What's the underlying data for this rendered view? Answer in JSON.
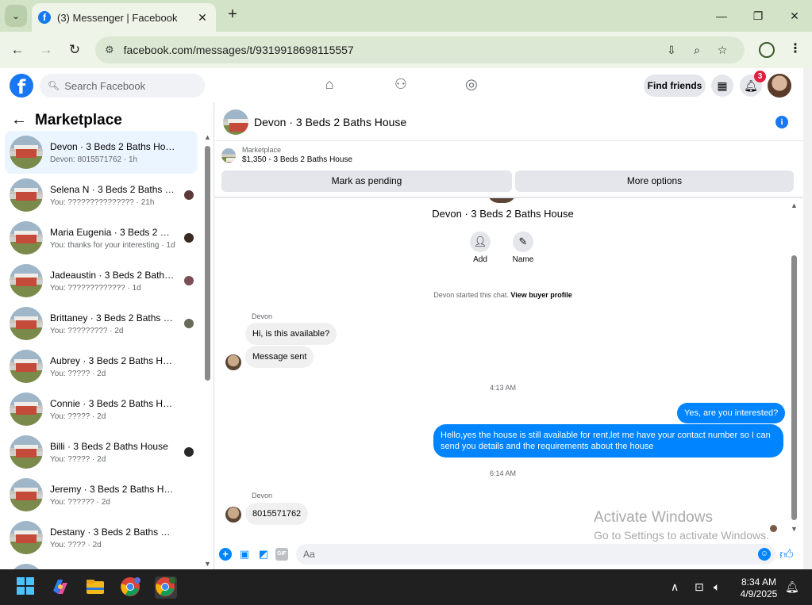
{
  "browser": {
    "tab_title": "(3) Messenger | Facebook",
    "url": "facebook.com/messages/t/9319918698115557"
  },
  "fb_header": {
    "search_placeholder": "Search Facebook",
    "find_friends": "Find friends",
    "notification_count": "3"
  },
  "sidebar": {
    "title": "Marketplace",
    "conversations": [
      {
        "name": "Devon · 3 Beds 2 Baths House",
        "preview": "Devon: 8015571762 · 1h",
        "active": true
      },
      {
        "name": "Selena N · 3 Beds 2 Baths Ho...",
        "preview": "You: ??????????????? · 21h"
      },
      {
        "name": "Maria Eugenia · 3 Beds 2 Bat...",
        "preview": "You: thanks for your interesting · 1d"
      },
      {
        "name": "Jadeaustin · 3 Beds 2 Baths H...",
        "preview": "You: ????????????? · 1d"
      },
      {
        "name": "Brittaney · 3 Beds 2 Baths Ho...",
        "preview": "You: ????????? · 2d"
      },
      {
        "name": "Aubrey · 3 Beds 2 Baths House",
        "preview": "You: ????? · 2d"
      },
      {
        "name": "Connie · 3 Beds 2 Baths House",
        "preview": "You: ????? · 2d"
      },
      {
        "name": "Billi · 3 Beds 2 Baths House",
        "preview": "You: ????? · 2d"
      },
      {
        "name": "Jeremy · 3 Beds 2 Baths House",
        "preview": "You: ?????? · 2d"
      },
      {
        "name": "Destany · 3 Beds 2 Baths House",
        "preview": "You: ???? · 2d"
      }
    ]
  },
  "chat": {
    "title": "Devon · 3 Beds 2 Baths House",
    "listing_label": "Marketplace",
    "listing_price": "$1,350 - 3 Beds 2 Baths House",
    "mark_pending": "Mark as pending",
    "more_options": "More options",
    "center_title": "Devon · 3 Beds 2 Baths House",
    "add_label": "Add",
    "name_label": "Name",
    "started_text": "Devon started this chat.",
    "view_profile": "View buyer profile",
    "sender_name": "Devon",
    "msg1": "Hi, is this available?",
    "msg2": "Message sent",
    "time1": "4:13 AM",
    "out1": "Yes, are you interested?",
    "out2": "Hello,yes the house is still available for rent,let me have your contact number so I can send you details and the requirements about the house",
    "time2": "6:14 AM",
    "msg3": "8015571762",
    "input_placeholder": "Aa"
  },
  "watermark": {
    "title": "Activate Windows",
    "sub": "Go to Settings to activate Windows."
  },
  "taskbar": {
    "time": "8:34 AM",
    "date": "4/9/2025"
  },
  "colors": {
    "fb_blue": "#1877f2",
    "messenger_blue": "#0084ff",
    "chrome_green": "#d3e3c7"
  }
}
